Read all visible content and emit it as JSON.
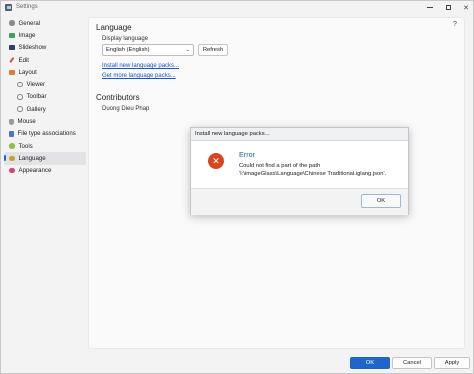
{
  "window": {
    "title": "Settings"
  },
  "sidebar": {
    "items": [
      {
        "label": "General",
        "icon": "gear-icon",
        "color": "#8a8a8a"
      },
      {
        "label": "Image",
        "icon": "image-icon",
        "color": "#3aa55a"
      },
      {
        "label": "Slideshow",
        "icon": "slideshow-icon",
        "color": "#2f3d6b"
      },
      {
        "label": "Edit",
        "icon": "pencil-icon",
        "color": "#d94b3b"
      },
      {
        "label": "Layout",
        "icon": "layout-icon",
        "color": "#e07b39"
      },
      {
        "label": "Viewer",
        "icon": "circle-icon",
        "color": "#888888"
      },
      {
        "label": "Toolbar",
        "icon": "circle-icon",
        "color": "#888888"
      },
      {
        "label": "Gallery",
        "icon": "circle-icon",
        "color": "#888888"
      },
      {
        "label": "Mouse",
        "icon": "mouse-icon",
        "color": "#9a9a9a"
      },
      {
        "label": "File type associations",
        "icon": "file-icon",
        "color": "#4a78c9"
      },
      {
        "label": "Tools",
        "icon": "tools-icon",
        "color": "#8cc04a"
      },
      {
        "label": "Language",
        "icon": "language-icon",
        "color": "#c9a227"
      },
      {
        "label": "Appearance",
        "icon": "palette-icon",
        "color": "#d6456a"
      }
    ],
    "active_index": 11
  },
  "content": {
    "language_title": "Language",
    "display_language_label": "Display language",
    "language_select_value": "English (English)",
    "refresh_label": "Refresh",
    "install_link": "Install new language packs...",
    "get_more_link": "Get more language packs...",
    "contributors_title": "Contributors",
    "contributor_name": "Duong Dieu Phap",
    "help_label": "?"
  },
  "footer": {
    "ok_label": "OK",
    "cancel_label": "Cancel",
    "apply_label": "Apply"
  },
  "dialog": {
    "title": "Install new language packs...",
    "heading": "Error",
    "message_line1": "Could not find a part of the path",
    "message_line2": "'I:\\imageGlass\\Language\\Chinese Traditional.iglang.json'.",
    "ok_label": "OK",
    "icon_glyph": "✕"
  },
  "colors": {
    "accent": "#1f66c9",
    "error": "#d6461f",
    "link": "#1a55c7"
  }
}
